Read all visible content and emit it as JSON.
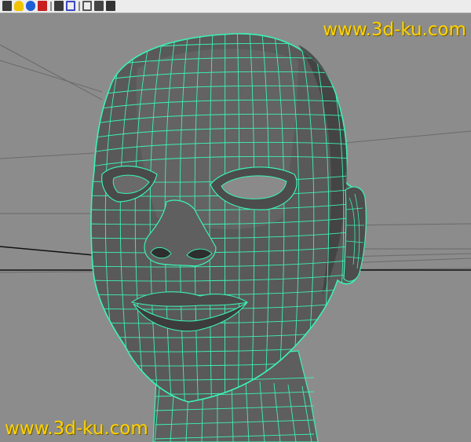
{
  "toolbar": {
    "tools": [
      {
        "name": "select-tool-icon",
        "color": "#3a3a3a"
      },
      {
        "name": "light-bulb-icon",
        "color": "#f2c300"
      },
      {
        "name": "sphere-icon",
        "color": "#1d5fd6"
      },
      {
        "name": "red-cube-icon",
        "color": "#c82020"
      },
      {
        "name": "render-icon",
        "color": "#3a3a3a"
      },
      {
        "name": "frame-icon",
        "color": "#3b46c4"
      },
      {
        "name": "wire-cube-icon",
        "color": "#555555"
      },
      {
        "name": "grid-icon",
        "color": "#444444"
      },
      {
        "name": "brush-icon",
        "color": "#333333"
      }
    ]
  },
  "viewport": {
    "background": "#8c8c8c",
    "wire_color": "#3cf2b4",
    "shade_color": "#5a5a5a",
    "model": "head-wireframe-mesh"
  },
  "watermarks": {
    "top": "www.3d-ku.com",
    "bottom": "www.3d-ku.com"
  }
}
